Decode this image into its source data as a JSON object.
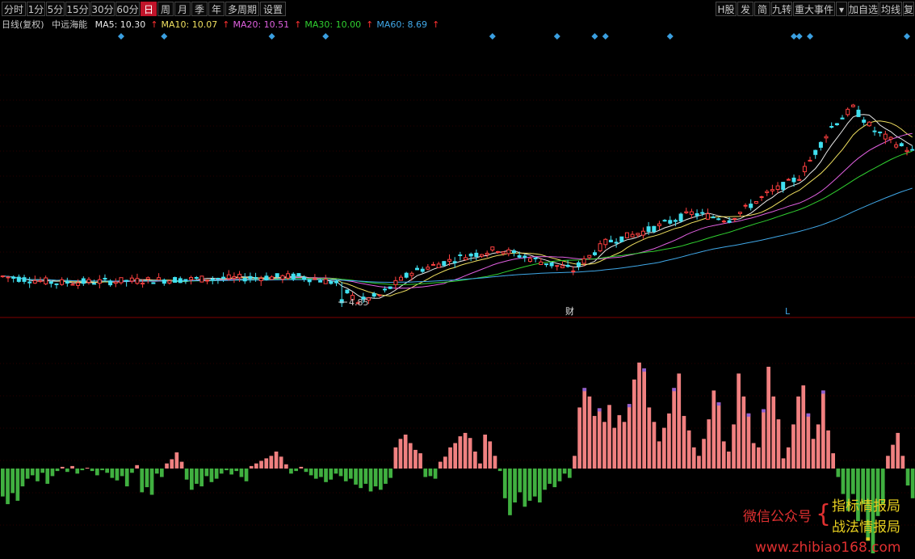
{
  "toolbar": {
    "left": [
      "分时",
      "1分",
      "5分",
      "15分",
      "30分",
      "60分",
      "日",
      "周",
      "月",
      "季",
      "年",
      "多周期",
      "设置"
    ],
    "active": "日",
    "right": [
      "H股",
      "发",
      "简",
      "九转",
      "重大事件",
      "▾",
      "加自选",
      "均线",
      "复"
    ]
  },
  "info": {
    "period": "日线(复权)",
    "name": "中远海能",
    "ma": [
      {
        "label": "MA5: 10.30",
        "arrow": "↑",
        "color": "#e8e8e8"
      },
      {
        "label": "MA10: 10.07",
        "arrow": "↑",
        "color": "#f0e060"
      },
      {
        "label": "MA20: 10.51",
        "arrow": "↑",
        "color": "#e060e0"
      },
      {
        "label": "MA30: 10.00",
        "arrow": "↑",
        "color": "#30d030"
      },
      {
        "label": "MA60: 8.69",
        "arrow": "↑",
        "color": "#40a8e8"
      }
    ]
  },
  "markers": {
    "low_label": "4.85",
    "cai": "财",
    "L": "L"
  },
  "watermark": {
    "wechat": "微信公众号",
    "brace": "{",
    "line1": "指标情报局",
    "line2": "战法情报局",
    "url": "www.zhibiao168.com"
  },
  "colors": {
    "up": "#ff4040",
    "down": "#40e0f0",
    "hist_pos": "#f08080",
    "hist_neg": "#40b040",
    "divider": "#800000"
  },
  "chart_data": {
    "type": "candlestick",
    "candles": {
      "count": 170,
      "price_range": [
        4.85,
        15.2
      ],
      "low_mark": 4.85
    },
    "series": [
      {
        "name": "MA5"
      },
      {
        "name": "MA10"
      },
      {
        "name": "MA20"
      },
      {
        "name": "MA30"
      },
      {
        "name": "MA60"
      }
    ],
    "histogram": {
      "values": [
        -0.33,
        -0.42,
        -0.29,
        -0.38,
        -0.21,
        -0.12,
        -0.08,
        -0.15,
        -0.05,
        -0.18,
        -0.09,
        -0.03,
        0.02,
        -0.04,
        0.03,
        -0.06,
        -0.02,
        0.01,
        -0.03,
        -0.08,
        -0.02,
        -0.05,
        -0.11,
        -0.14,
        -0.09,
        -0.21,
        -0.05,
        0.04,
        -0.28,
        -0.22,
        -0.31,
        -0.06,
        -0.1,
        0.06,
        0.11,
        0.19,
        0.08,
        -0.13,
        -0.25,
        -0.18,
        -0.21,
        -0.09,
        -0.16,
        -0.12,
        -0.06,
        -0.02,
        -0.07,
        -0.03,
        -0.1,
        -0.15,
        0.03,
        0.06,
        0.09,
        0.12,
        0.15,
        0.2,
        0.14,
        0.05,
        -0.06,
        -0.03,
        0.02,
        -0.04,
        -0.08,
        -0.12,
        -0.1,
        -0.16,
        -0.13,
        -0.06,
        -0.09,
        -0.15,
        -0.12,
        -0.19,
        -0.23,
        -0.18,
        -0.27,
        -0.21,
        -0.25,
        -0.18,
        -0.11,
        0.25,
        0.35,
        0.4,
        0.3,
        0.22,
        0.18,
        -0.1,
        -0.09,
        -0.12,
        0.08,
        0.14,
        0.25,
        0.3,
        0.38,
        0.42,
        0.36,
        0.2,
        0.06,
        0.4,
        0.32,
        0.15,
        -0.03,
        -0.35,
        -0.55,
        -0.4,
        -0.28,
        -0.45,
        -0.38,
        -0.33,
        -0.4,
        -0.25,
        -0.18,
        -0.22,
        -0.15,
        -0.06,
        -0.11,
        0.15,
        0.72,
        0.95,
        0.85,
        0.62,
        0.71,
        0.55,
        0.75,
        0.48,
        0.63,
        0.55,
        0.76,
        1.05,
        1.25,
        1.18,
        0.72,
        0.55,
        0.32,
        0.48,
        0.65,
        0.95,
        1.12,
        0.62,
        0.45,
        0.25,
        0.15,
        0.35,
        0.58,
        0.92,
        0.78,
        0.32,
        0.2,
        0.52,
        1.12,
        0.85,
        0.65,
        0.3,
        0.25,
        0.7,
        1.2,
        0.85,
        0.58,
        0.12,
        0.25,
        0.52,
        0.85,
        0.98,
        0.65,
        0.35,
        0.52,
        0.92,
        0.45,
        0.18,
        -0.1,
        -0.3,
        -0.5,
        -0.3,
        -0.62,
        -0.42,
        -0.85,
        -1.0,
        -0.56,
        -0.42,
        0.15,
        0.28,
        0.42,
        0.15,
        -0.2,
        -0.35
      ]
    }
  }
}
